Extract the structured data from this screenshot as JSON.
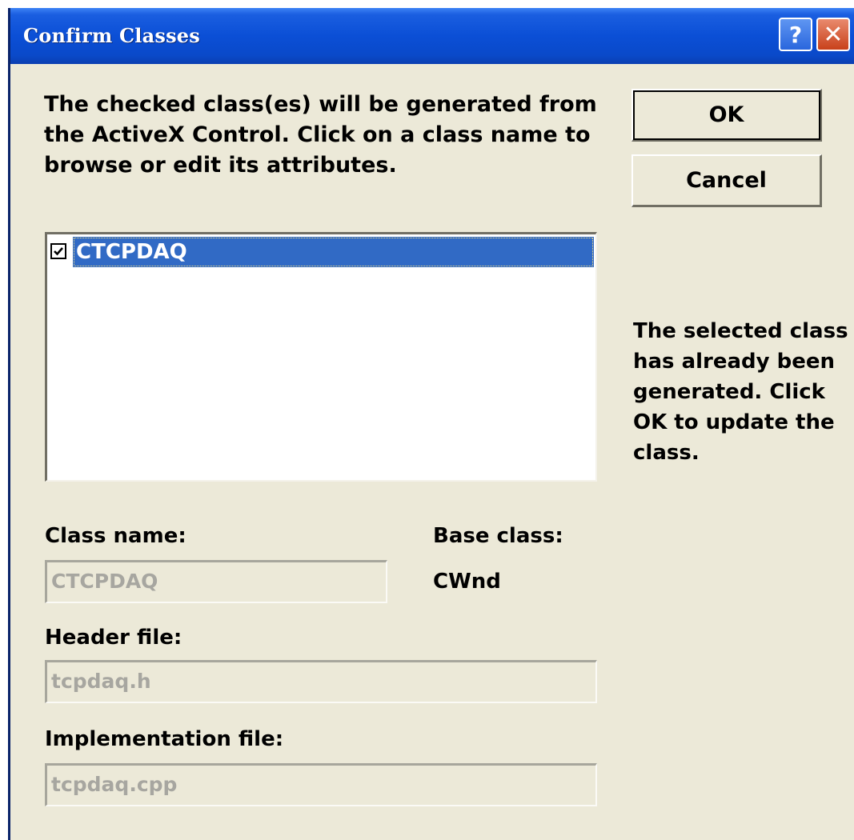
{
  "window": {
    "title": "Confirm Classes",
    "help_glyph": "?",
    "close_glyph": "✕"
  },
  "description": "The checked class(es) will be generated from the ActiveX Control.  Click on a class name to browse or edit its attributes.",
  "buttons": {
    "ok_label": "OK",
    "cancel_label": "Cancel"
  },
  "class_list": {
    "items": [
      {
        "label": "CTCPDAQ",
        "checked": true,
        "selected": true
      }
    ]
  },
  "status_note": "The selected class has already been generated. Click OK to update the class.",
  "fields": {
    "class_name_label": "Class name:",
    "class_name_value": "CTCPDAQ",
    "base_class_label": "Base class:",
    "base_class_value": "CWnd",
    "header_file_label": "Header file:",
    "header_file_value": "tcpdaq.h",
    "impl_file_label": "Implementation file:",
    "impl_file_value": "tcpdaq.cpp"
  },
  "colors": {
    "titlebar": "#0b4fd6",
    "dialog_bg": "#ece9d8",
    "selection": "#316ac5",
    "disabled_text": "#a7a6a0"
  }
}
